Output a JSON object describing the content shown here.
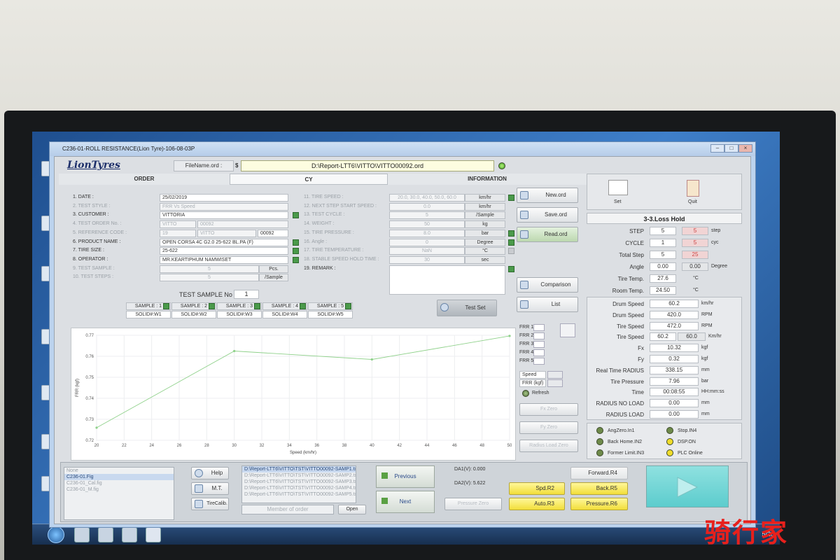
{
  "window": {
    "title": "C236-01-ROLL RESISTANCE(Lion Tyre)-106-08-03P"
  },
  "header": {
    "logo": "LionTyres",
    "filename_label": "FileName.ord :",
    "filename_value": "D:\\Report-LTT6\\VITTO\\VITTO00092.ord"
  },
  "tabs": {
    "order": "ORDER",
    "cy": "CY",
    "information": "INFORMATION"
  },
  "order_fields": [
    {
      "label": "1. DATE :",
      "value": "25/02/2019"
    },
    {
      "label": "2. TEST STYLE :",
      "value": "FRR Vs Speed"
    },
    {
      "label": "3. CUSTOMER :",
      "value": "VITTORIA"
    },
    {
      "label": "4. TEST ORDER No. :",
      "value": "VITTO",
      "value2": "00092"
    },
    {
      "label": "5. REFERENCE CODE :",
      "value": "19",
      "value2": "VITTO",
      "value3": "00092"
    },
    {
      "label": "6. PRODUCT NAME :",
      "value": "OPEN CORSA 4C G2.0 25-622 BL.PA (F)"
    },
    {
      "label": "7. TIRE SIZE :",
      "value": "25-622"
    },
    {
      "label": "8. OPERATOR :",
      "value": "MR.KEARTIPHUM NAMWISET"
    },
    {
      "label": "9. TEST SAMPLE :",
      "value": "5",
      "unit": "Pcs."
    },
    {
      "label": "10. TEST STEPS :",
      "value": "5",
      "unit": "/Sample"
    }
  ],
  "info_fields": [
    {
      "label": "11. TIRE SPEED :",
      "value": "20.0, 30.0, 40.0, 50.0, 60.0",
      "unit": "km/hr"
    },
    {
      "label": "12. NEXT STEP START SPEED :",
      "value": "0.0",
      "unit": "km/hr"
    },
    {
      "label": "13. TEST CYCLE :",
      "value": "5",
      "unit": "/Sample"
    },
    {
      "label": "14. WEIGHT :",
      "value": "50",
      "unit": "kg"
    },
    {
      "label": "15. TIRE PRESSURE :",
      "value": "8.0",
      "unit": "bar"
    },
    {
      "label": "16. Angle :",
      "value": "0",
      "unit": "Degree"
    },
    {
      "label": "17. TIRE TEMPERATURE :",
      "value": "NaN",
      "unit": "°C"
    },
    {
      "label": "18. STABLE SPEED HOLD TIME :",
      "value": "30",
      "unit": "sec"
    },
    {
      "label": "19. REMARK :",
      "value": ""
    }
  ],
  "side_buttons": {
    "new": "New.ord",
    "save": "Save.ord",
    "read": "Read.ord",
    "comparison": "Comparison",
    "list": "List",
    "test_set": "Test Set"
  },
  "test_sample": {
    "label": "TEST SAMPLE No :",
    "value": "1"
  },
  "samples": [
    {
      "label": "SAMPLE : 1",
      "solid": "SOLID#:W1"
    },
    {
      "label": "SAMPLE : 2",
      "solid": "SOLID#:W2"
    },
    {
      "label": "SAMPLE : 3",
      "solid": "SOLID#:W3"
    },
    {
      "label": "SAMPLE : 4",
      "solid": "SOLID#:W4"
    },
    {
      "label": "SAMPLE : 5",
      "solid": "SOLID#:W5"
    }
  ],
  "chart_data": {
    "type": "line",
    "xlabel": "Speed (km/hr)",
    "ylabel": "FRR (kgf)",
    "xlim": [
      20,
      50
    ],
    "ylim": [
      0.72,
      0.77
    ],
    "xticks": [
      20,
      22,
      24,
      26,
      28,
      30,
      32,
      34,
      36,
      38,
      40,
      42,
      44,
      46,
      48,
      50
    ],
    "yticks": [
      0.72,
      0.73,
      0.74,
      0.75,
      0.76,
      0.77
    ],
    "x": [
      20,
      30,
      40,
      50
    ],
    "y": [
      0.726,
      0.7625,
      0.7585,
      0.7697
    ],
    "grid": true
  },
  "chart_side": {
    "frr": [
      "FRR 1",
      "FRR 2",
      "FRR 3",
      "FRR 4",
      "FRR 5"
    ],
    "axes": [
      "Speed",
      "FRR (kgf)"
    ],
    "refresh": "Refresh",
    "zero_buttons": [
      "Fx Zero",
      "Fy Zero",
      "Radius Load Zero"
    ]
  },
  "top_right": {
    "set": "Set",
    "quit": "Quit",
    "status_title": "3-3.Loss Hold"
  },
  "status_rows": [
    {
      "label": "STEP",
      "value": "5",
      "value2": "5",
      "unit": "step"
    },
    {
      "label": "CYCLE",
      "value": "1",
      "value2": "5",
      "unit": "cyc"
    },
    {
      "label": "Total Step",
      "value": "5",
      "value2": "25",
      "unit": ""
    },
    {
      "label": "Angle",
      "value": "0.00",
      "value2": "0.00",
      "unit": "Degree"
    },
    {
      "label": "Tire Temp.",
      "value": "27.6",
      "unit": "°C"
    },
    {
      "label": "Room Temp.",
      "value": "24.50",
      "unit": "°C"
    }
  ],
  "measure_rows": [
    {
      "label": "Drum Speed",
      "value": "60.2",
      "unit": "km/hr"
    },
    {
      "label": "Drum Speed",
      "value": "420.0",
      "unit": "RPM"
    },
    {
      "label": "Tire Speed",
      "value": "472.0",
      "unit": "RPM"
    },
    {
      "label": "Tire Speed",
      "value": "60.2",
      "value2": "60.0",
      "unit": "Km/hr"
    },
    {
      "label": "Fx",
      "value": "10.32",
      "unit": "kgf"
    },
    {
      "label": "Fy",
      "value": "0.32",
      "unit": "kgf"
    },
    {
      "label": "Real Time RADIUS",
      "value": "338.15",
      "unit": "mm"
    },
    {
      "label": "Tire Pressure",
      "value": "7.96",
      "unit": "bar"
    },
    {
      "label": "Time",
      "value": "00:08:55",
      "unit": "HH:mm:ss"
    },
    {
      "label": "RADIUS NO LOAD",
      "value": "0.00",
      "unit": "mm"
    },
    {
      "label": "RADIUS LOAD",
      "value": "0.00",
      "unit": "mm"
    }
  ],
  "indicators": [
    {
      "label": "AngZero.In1",
      "color": "#6e8a4a"
    },
    {
      "label": "Stop.IN4",
      "color": "#6e8a4a"
    },
    {
      "label": "Back Home.IN2",
      "color": "#6e8a4a"
    },
    {
      "label": "DSP.ON",
      "color": "#f0dc2a"
    },
    {
      "label": "Former Limit.IN3",
      "color": "#6e8a4a"
    },
    {
      "label": "PLC Online",
      "color": "#f0dc2a"
    }
  ],
  "bottom": {
    "files": [
      "None",
      "C236-01.Fig",
      "C236-01_Cal.fig",
      "C236-01_M.fig"
    ],
    "help": "Help",
    "mt": "M.T.",
    "tirecalib": "TireCalib.",
    "samples_list": [
      "D:\\Report-LTT6\\VITTO\\TST\\VITTO00092-SAMP1.txt",
      "D:\\Report-LTT6\\VITTO\\TST\\VITTO00092-SAMP2.txt",
      "D:\\Report-LTT6\\VITTO\\TST\\VITTO00092-SAMP3.txt",
      "D:\\Report-LTT6\\VITTO\\TST\\VITTO00092-SAMP4.txt",
      "D:\\Report-LTT6\\VITTO\\TST\\VITTO00092-SAMP5.txt"
    ],
    "member_placeholder": "Member of order",
    "open": "Open",
    "previous": "Previous",
    "next": "Next",
    "da1": "DA1(V):  0.000",
    "da2": "DA2(V):  5.622",
    "pressure_zero": "Pressure Zero",
    "forward": "Forward.R4",
    "spd": "Spd.R2",
    "back": "Back.R5",
    "auto": "Auto.R3",
    "pressure": "Pressure.R6"
  },
  "watermark": "骑行家"
}
